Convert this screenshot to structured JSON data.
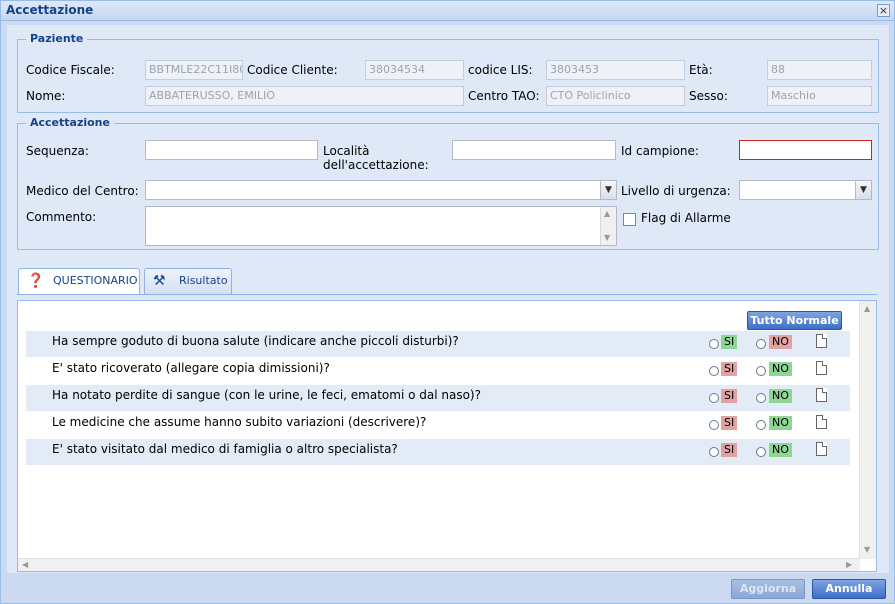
{
  "window": {
    "title": "Accettazione",
    "close_glyph": "×"
  },
  "paziente": {
    "legend": "Paziente",
    "codice_fiscale": {
      "label": "Codice Fiscale:",
      "value": "BBTMLE22C11I80"
    },
    "codice_cliente": {
      "label": "Codice Cliente:",
      "value": "38034534"
    },
    "codice_lis": {
      "label": "codice LIS:",
      "value": "3803453"
    },
    "eta": {
      "label": "Età:",
      "value": "88"
    },
    "nome": {
      "label": "Nome:",
      "value": "ABBATERUSSO, EMILIO"
    },
    "centro_tao": {
      "label": "Centro TAO:",
      "value": "CTO Policlinico"
    },
    "sesso": {
      "label": "Sesso:",
      "value": "Maschio"
    }
  },
  "accettazione": {
    "legend": "Accettazione",
    "sequenza": {
      "label": "Sequenza:",
      "value": ""
    },
    "localita": {
      "label_line1": "Località",
      "label_line2": "dell'accettazione:",
      "value": ""
    },
    "id_campione": {
      "label": "Id campione:",
      "value": ""
    },
    "medico": {
      "label": "Medico del Centro:",
      "value": ""
    },
    "urgenza": {
      "label": "Livello di urgenza:",
      "value": ""
    },
    "commento": {
      "label": "Commento:",
      "value": ""
    },
    "flag_allarme": {
      "label": "Flag di Allarme",
      "checked": false
    }
  },
  "tabs": [
    {
      "label": "QUESTIONARIO",
      "icon": "question-person-icon",
      "active": true
    },
    {
      "label": "Risultato",
      "icon": "tools-icon",
      "active": false
    }
  ],
  "questionario": {
    "tutto_normale_label": "Tutto Normale",
    "si_label": "SI",
    "no_label": "NO",
    "questions": [
      {
        "text": "Ha sempre goduto di buona salute (indicare anche piccoli disturbi)?",
        "normal": "SI"
      },
      {
        "text": "E' stato ricoverato (allegare copia dimissioni)?",
        "normal": "NO"
      },
      {
        "text": "Ha notato perdite di sangue (con le urine, le feci, ematomi o dal naso)?",
        "normal": "NO"
      },
      {
        "text": "Le medicine che assume hanno subito variazioni (descrivere)?",
        "normal": "NO"
      },
      {
        "text": "E' stato visitato dal medico di famiglia o altro specialista?",
        "normal": "NO"
      }
    ]
  },
  "footer": {
    "aggiorna_label": "Aggiorna",
    "annulla_label": "Annulla"
  },
  "colors": {
    "accent": "#15428b",
    "green": "#8fd694",
    "red": "#e3a2a2",
    "error_border": "#d62020"
  }
}
